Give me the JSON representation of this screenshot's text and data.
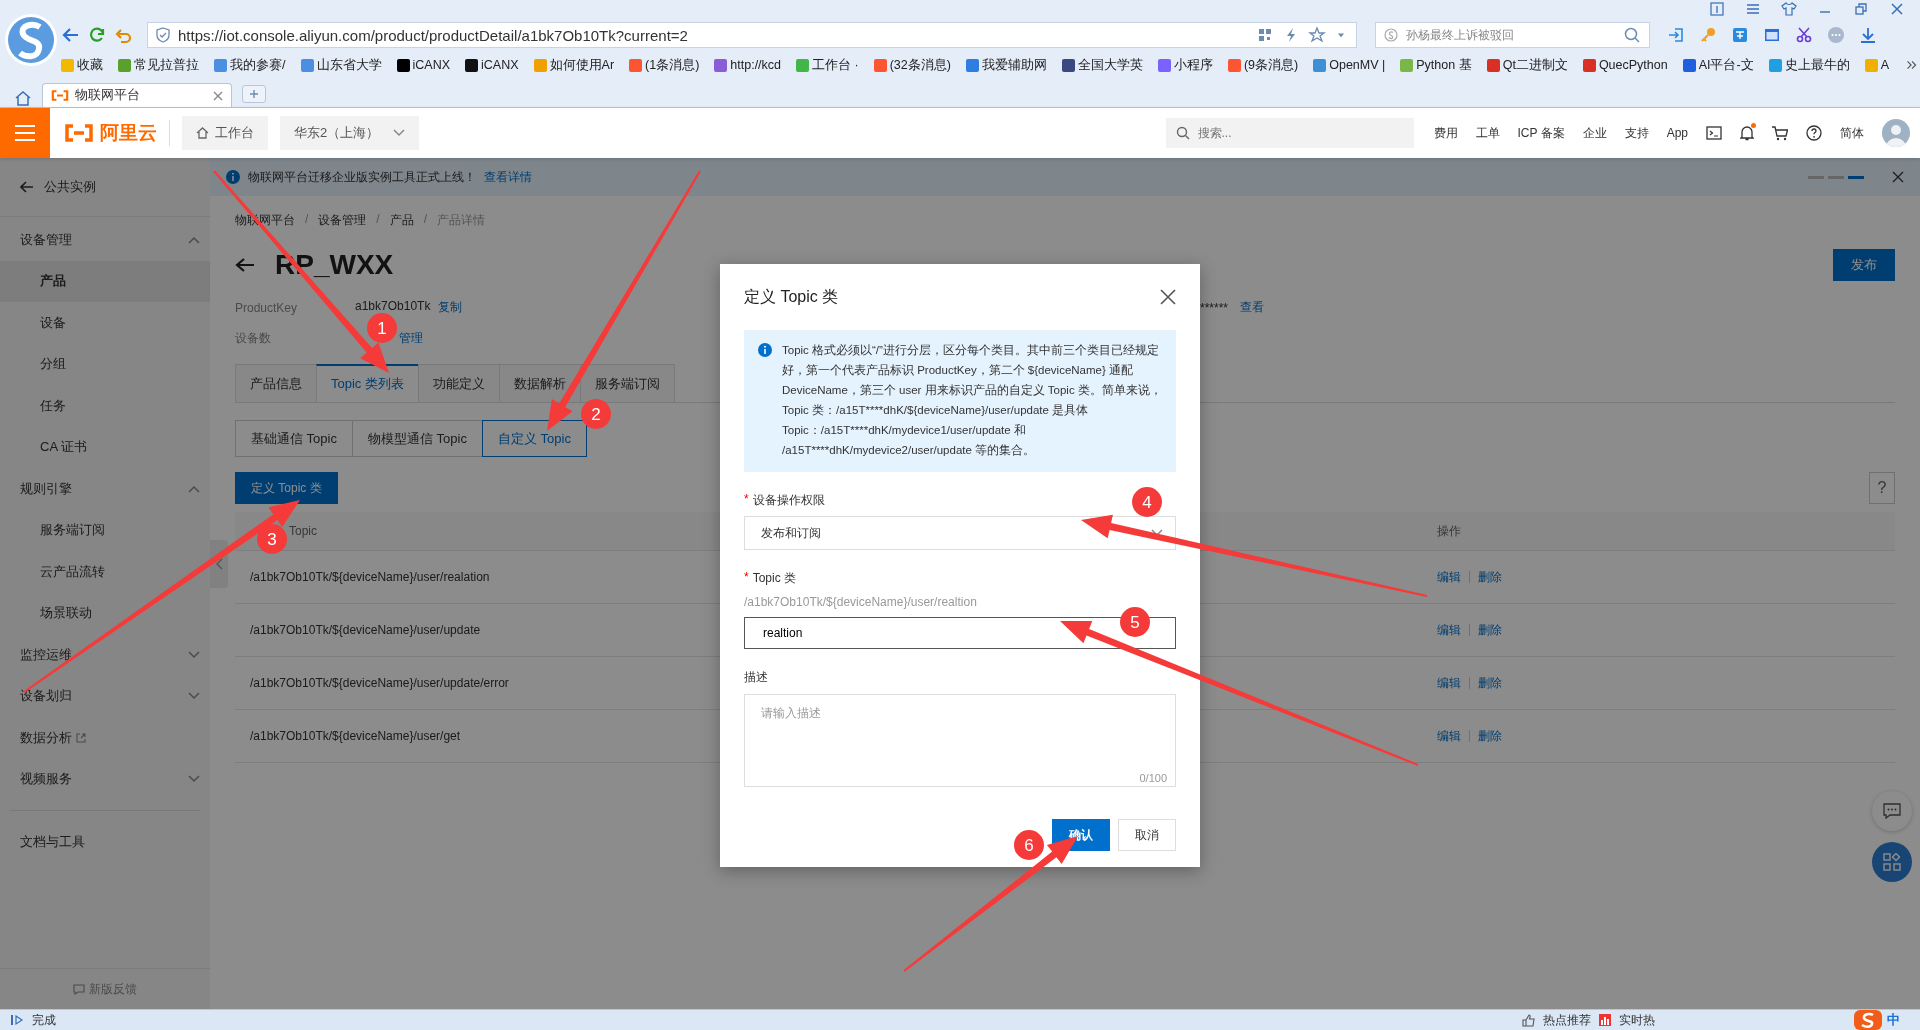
{
  "browser": {
    "address": {
      "url": "https://iot.console.aliyun.com/product/productDetail/a1bk7Ob10Tk?current=2"
    },
    "search": {
      "placeholder": "孙杨最终上诉被驳回"
    },
    "bookmarks": [
      {
        "label": "收藏",
        "color": "#f5b800"
      },
      {
        "label": "常见拉普拉",
        "color": "#5aa02c"
      },
      {
        "label": "我的参赛/",
        "color": "#4a8fe0"
      },
      {
        "label": "山东省大学",
        "color": "#4a8fe1"
      },
      {
        "label": "iCANX",
        "color": "#000000"
      },
      {
        "label": "iCANX",
        "color": "#111111"
      },
      {
        "label": "如何使用Ar",
        "color": "#f0a000"
      },
      {
        "label": "(1条消息)",
        "color": "#fc5531"
      },
      {
        "label": "http://kcd",
        "color": "#8a5cd6"
      },
      {
        "label": "工作台 ·",
        "color": "#43b649"
      },
      {
        "label": "(32条消息)",
        "color": "#fc5532"
      },
      {
        "label": "我爱辅助网",
        "color": "#2f7de1"
      },
      {
        "label": "全国大学英",
        "color": "#3a4a80"
      },
      {
        "label": "小程序",
        "color": "#7b61ff"
      },
      {
        "label": "(9条消息)",
        "color": "#fc5533"
      },
      {
        "label": "OpenMV |",
        "color": "#3d8fd6"
      },
      {
        "label": "Python 基",
        "color": "#7ab648"
      },
      {
        "label": "Qt二进制文",
        "color": "#d93025"
      },
      {
        "label": "QuecPython",
        "color": "#d93026"
      },
      {
        "label": "AI平台-文",
        "color": "#2060e0"
      },
      {
        "label": "史上最牛的",
        "color": "#20a0e0"
      },
      {
        "label": "A",
        "color": "#f0b000"
      }
    ],
    "tabs": [
      {
        "label": "物联网平台",
        "selected": true
      }
    ]
  },
  "header": {
    "brand": "阿里云",
    "workbench": "工作台",
    "region": "华东2（上海）",
    "search_placeholder": "搜索...",
    "nav": [
      "费用",
      "工单",
      "ICP 备案",
      "企业",
      "支持",
      "App"
    ],
    "unread": true,
    "language": "简体"
  },
  "notice": {
    "text": "物联网平台迁移企业版实例工具正式上线！",
    "link": "查看详情",
    "slides": [
      {
        "selected": false
      },
      {
        "selected": false
      },
      {
        "selected": true
      }
    ]
  },
  "sidebar": {
    "back": "公共实例",
    "sections": [
      {
        "kind": "group",
        "label": "设备管理",
        "expanded": true,
        "children": [
          {
            "label": "产品",
            "selected": true
          },
          {
            "label": "设备",
            "selected": false
          },
          {
            "label": "分组",
            "selected": false
          },
          {
            "label": "任务",
            "selected": false
          },
          {
            "label": "CA 证书",
            "selected": false
          }
        ]
      },
      {
        "kind": "group",
        "label": "规则引擎",
        "expanded": true,
        "children": [
          {
            "label": "服务端订阅",
            "selected": false
          },
          {
            "label": "云产品流转",
            "selected": false
          },
          {
            "label": "场景联动",
            "selected": false
          }
        ]
      },
      {
        "kind": "group",
        "label": "监控运维",
        "expanded": false
      },
      {
        "kind": "group",
        "label": "设备划归",
        "expanded": false
      },
      {
        "kind": "external",
        "label": "数据分析"
      },
      {
        "kind": "group",
        "label": "视频服务",
        "expanded": false
      },
      {
        "kind": "divider"
      },
      {
        "kind": "link",
        "label": "文档与工具"
      }
    ],
    "feedback": "新版反馈"
  },
  "product": {
    "breadcrumb": [
      "物联网平台",
      "设备管理",
      "产品",
      "产品详情"
    ],
    "breadcrumb_separator": "/",
    "title": "RP_WXX",
    "publish": "发布",
    "fields": [
      {
        "label": "ProductKey",
        "value": "a1bk7Ob10Tk",
        "link": "复制"
      },
      {
        "label": "设备数",
        "link": "管理"
      }
    ],
    "secret": {
      "value": "******",
      "link": "查看"
    },
    "tabs": [
      {
        "label": "产品信息",
        "selected": false
      },
      {
        "label": "Topic 类列表",
        "selected": true
      },
      {
        "label": "功能定义",
        "selected": false
      },
      {
        "label": "数据解析",
        "selected": false
      },
      {
        "label": "服务端订阅",
        "selected": false
      }
    ],
    "subtabs": [
      {
        "label": "基础通信 Topic",
        "selected": false
      },
      {
        "label": "物模型通信 Topic",
        "selected": false
      },
      {
        "label": "自定义 Topic",
        "selected": true
      }
    ],
    "define_button": "定义 Topic 类",
    "help": "?",
    "table": {
      "columns": [
        "Topic",
        "操作"
      ],
      "rows": [
        {
          "topic": "/a1bk7Ob10Tk/${deviceName}/user/realation",
          "actions": [
            "编辑",
            "删除"
          ]
        },
        {
          "topic": "/a1bk7Ob10Tk/${deviceName}/user/update",
          "actions": [
            "编辑",
            "删除"
          ]
        },
        {
          "topic": "/a1bk7Ob10Tk/${deviceName}/user/update/error",
          "actions": [
            "编辑",
            "删除"
          ]
        },
        {
          "topic": "/a1bk7Ob10Tk/${deviceName}/user/get",
          "actions": [
            "编辑",
            "删除"
          ]
        }
      ]
    }
  },
  "dialog": {
    "title": "定义 Topic 类",
    "required_mark": "*",
    "info": "Topic 格式必须以“/”进行分层，区分每个类目。其中前三个类目已经规定好，第一个代表产品标识 ProductKey，第二个 ${deviceName} 通配 DeviceName，第三个 user 用来标识产品的自定义 Topic 类。简单来说，Topic 类：/a15T****dhK/${deviceName}/user/update 是具体 Topic：/a15T****dhK/mydevice1/user/update 和 /a15T****dhK/mydevice2/user/update 等的集合。",
    "permission": {
      "label": "设备操作权限",
      "required": true,
      "value": "发布和订阅"
    },
    "topic": {
      "label": "Topic 类",
      "required": true,
      "hint": "/a1bk7Ob10Tk/${deviceName}/user/realtion",
      "value": "realtion"
    },
    "description": {
      "label": "描述",
      "required": false,
      "placeholder": "请输入描述",
      "counter": "0/100"
    },
    "buttons": [
      {
        "label": "确认",
        "kind": "primary"
      },
      {
        "label": "取消",
        "kind": "secondary"
      }
    ]
  },
  "annotations": [
    {
      "number": "1"
    },
    {
      "number": "2"
    },
    {
      "number": "3"
    },
    {
      "number": "4"
    },
    {
      "number": "5"
    },
    {
      "number": "6"
    }
  ],
  "status_bar": {
    "text": "完成",
    "right": [
      "热点推荐",
      "实时热"
    ],
    "ime": "中"
  }
}
